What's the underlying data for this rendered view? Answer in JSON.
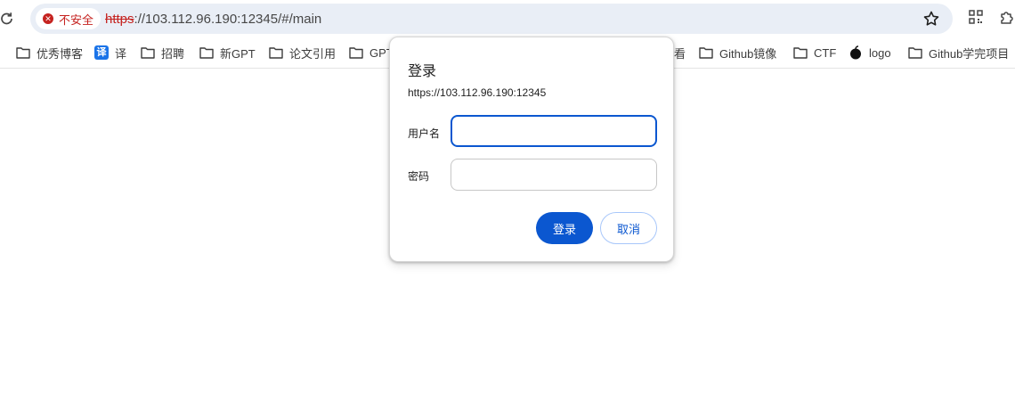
{
  "browser": {
    "security_label": "不安全",
    "url_scheme": "https",
    "url_rest": "://103.112.96.190:12345/#/main",
    "icons": [
      "reload-icon",
      "not-secure-icon",
      "bookmark-star-icon",
      "qr-code-icon",
      "extensions-icon"
    ]
  },
  "bookmarks": [
    {
      "label": "优秀博客",
      "icon": "folder-icon"
    },
    {
      "label": "译",
      "icon": "translate-icon"
    },
    {
      "label": "招聘",
      "icon": "folder-icon"
    },
    {
      "label": "新GPT",
      "icon": "folder-icon"
    },
    {
      "label": "论文引用",
      "icon": "folder-icon"
    },
    {
      "label": "GPT",
      "icon": "folder-icon"
    },
    {
      "label": "看",
      "icon": "none"
    },
    {
      "label": "Github镜像",
      "icon": "folder-icon"
    },
    {
      "label": "CTF",
      "icon": "folder-icon"
    },
    {
      "label": "logo",
      "icon": "apple-icon"
    },
    {
      "label": "Github学完项目",
      "icon": "folder-icon"
    }
  ],
  "dialog": {
    "title": "登录",
    "origin": "https://103.112.96.190:12345",
    "username_label": "用户名",
    "username_value": "",
    "password_label": "密码",
    "password_value": "",
    "login_button": "登录",
    "cancel_button": "取消"
  },
  "colors": {
    "accent": "#0b57d0",
    "warning": "#c5221f",
    "omnibox_bg": "#e9eef6"
  }
}
